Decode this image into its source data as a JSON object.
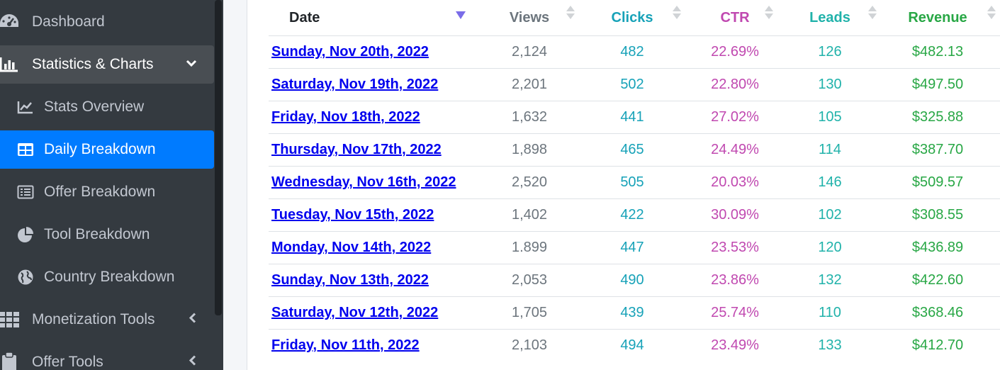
{
  "sidebar": {
    "items": [
      {
        "label": "Dashboard",
        "icon": "tachometer-icon"
      },
      {
        "label": "Statistics & Charts",
        "icon": "bar-chart-icon"
      },
      {
        "label": "Stats Overview",
        "icon": "line-chart-icon"
      },
      {
        "label": "Daily Breakdown",
        "icon": "table-icon"
      },
      {
        "label": "Offer Breakdown",
        "icon": "list-alt-icon"
      },
      {
        "label": "Tool Breakdown",
        "icon": "pie-chart-icon"
      },
      {
        "label": "Country Breakdown",
        "icon": "globe-icon"
      },
      {
        "label": "Monetization Tools",
        "icon": "grid-icon"
      },
      {
        "label": "Offer Tools",
        "icon": "clipboard-icon"
      }
    ]
  },
  "table": {
    "headers": {
      "date": "Date",
      "views": "Views",
      "clicks": "Clicks",
      "ctr": "CTR",
      "leads": "Leads",
      "revenue": "Revenue"
    },
    "rows": [
      {
        "date": "Sunday, Nov 20th, 2022",
        "views": "2,124",
        "clicks": "482",
        "ctr": "22.69%",
        "leads": "126",
        "revenue": "$482.13"
      },
      {
        "date": "Saturday, Nov 19th, 2022",
        "views": "2,201",
        "clicks": "502",
        "ctr": "22.80%",
        "leads": "130",
        "revenue": "$497.50"
      },
      {
        "date": "Friday, Nov 18th, 2022",
        "views": "1,632",
        "clicks": "441",
        "ctr": "27.02%",
        "leads": "105",
        "revenue": "$325.88"
      },
      {
        "date": "Thursday, Nov 17th, 2022",
        "views": "1,898",
        "clicks": "465",
        "ctr": "24.49%",
        "leads": "114",
        "revenue": "$387.70"
      },
      {
        "date": "Wednesday, Nov 16th, 2022",
        "views": "2,520",
        "clicks": "505",
        "ctr": "20.03%",
        "leads": "146",
        "revenue": "$509.57"
      },
      {
        "date": "Tuesday, Nov 15th, 2022",
        "views": "1,402",
        "clicks": "422",
        "ctr": "30.09%",
        "leads": "102",
        "revenue": "$308.55"
      },
      {
        "date": "Monday, Nov 14th, 2022",
        "views": "1.899",
        "clicks": "447",
        "ctr": "23.53%",
        "leads": "120",
        "revenue": "$436.89"
      },
      {
        "date": "Sunday, Nov 13th, 2022",
        "views": "2,053",
        "clicks": "490",
        "ctr": "23.86%",
        "leads": "132",
        "revenue": "$422.60"
      },
      {
        "date": "Saturday, Nov 12th, 2022",
        "views": "1,705",
        "clicks": "439",
        "ctr": "25.74%",
        "leads": "110",
        "revenue": "$368.46"
      },
      {
        "date": "Friday, Nov 11th, 2022",
        "views": "2,103",
        "clicks": "494",
        "ctr": "23.49%",
        "leads": "133",
        "revenue": "$412.70"
      }
    ]
  },
  "colors": {
    "sidebar_bg": "#343a40",
    "active_bg": "#007bff",
    "date_header": "#212529",
    "views": "#6c757d",
    "clicks": "#17a2b8",
    "ctr": "#c048b0",
    "leads": "#20b2aa",
    "revenue": "#28a745",
    "link": "#0000ee"
  }
}
